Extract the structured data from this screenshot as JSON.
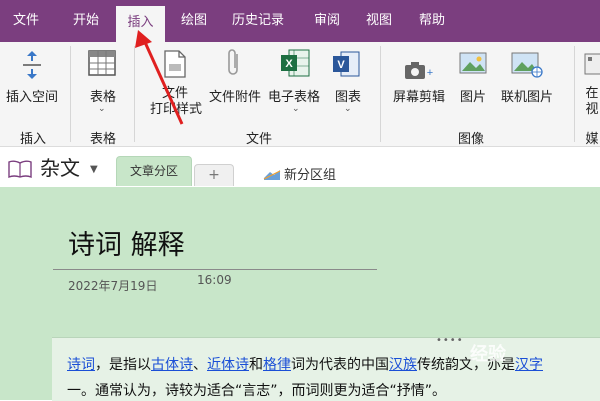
{
  "menu": {
    "items": [
      {
        "id": "file",
        "label": "文件"
      },
      {
        "id": "home",
        "label": "开始"
      },
      {
        "id": "insert",
        "label": "插入"
      },
      {
        "id": "draw",
        "label": "绘图"
      },
      {
        "id": "history",
        "label": "历史记录"
      },
      {
        "id": "review",
        "label": "审阅"
      },
      {
        "id": "view",
        "label": "视图"
      },
      {
        "id": "help",
        "label": "帮助"
      }
    ],
    "active": "插入"
  },
  "ribbon": {
    "insert_space": "插入空间",
    "table": "表格",
    "file_printout_line1": "文件",
    "file_printout_line2": "打印样式",
    "file_attachment": "文件附件",
    "spreadsheet": "电子表格",
    "chart": "图表",
    "screen_clipping": "屏幕剪辑",
    "picture": "图片",
    "online_picture": "联机图片",
    "video_partial_line1": "在",
    "video_partial_line2": "视",
    "groups": {
      "insert": "插入",
      "tables": "表格",
      "files": "文件",
      "images": "图像",
      "media_partial": "媒"
    }
  },
  "tabbar": {
    "notebook": "杂文",
    "section": "文章分区",
    "add": "+",
    "new_group": "新分区组"
  },
  "page": {
    "title": "诗词 解释",
    "date": "2022年7月19日",
    "time": "16:09",
    "line1": {
      "link1": "诗词",
      "t1": "，是指以",
      "link2": "古体诗",
      "t2": "、",
      "link3": "近体诗",
      "t3": "和",
      "link4": "格律",
      "t4": "词为代表的中国",
      "link5": "汉族",
      "t5": "传统韵文，亦是",
      "link6": "汉字"
    },
    "line2": "一。通常认为，诗较为适合“言志”，而词则更为适合“抒情”。"
  },
  "watermark": "经验"
}
